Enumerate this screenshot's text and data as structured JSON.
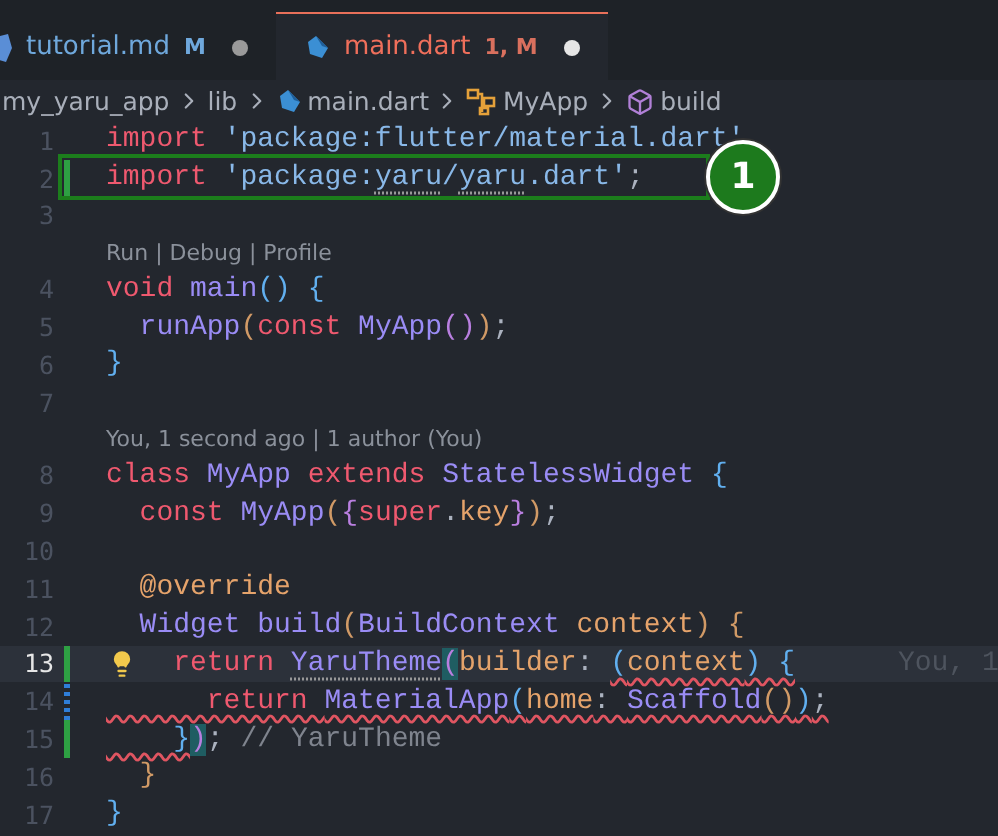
{
  "tabs": [
    {
      "label": "tutorial.md",
      "status": "M",
      "kind": "markdown",
      "selected": false,
      "dirty": true
    },
    {
      "label": "main.dart",
      "status": "1, M",
      "kind": "dart",
      "selected": true,
      "dirty": true
    }
  ],
  "breadcrumb": [
    {
      "label": "my_yaru_app",
      "kind": "folder"
    },
    {
      "label": "lib",
      "kind": "folder"
    },
    {
      "label": "main.dart",
      "kind": "dart"
    },
    {
      "label": "MyApp",
      "kind": "class"
    },
    {
      "label": "build",
      "kind": "method"
    }
  ],
  "annotation": {
    "label": "1"
  },
  "lines": [
    {
      "number": "1",
      "kind": "plain",
      "tokens": [
        {
          "t": "import ",
          "kind": "kw"
        },
        {
          "t": "'package:flutter/material.dart'",
          "kind": "str"
        }
      ]
    },
    {
      "number": "2",
      "kind": "added",
      "highlighted": true,
      "tokens": [
        {
          "t": "import ",
          "kind": "kw"
        },
        {
          "t": "'package:",
          "kind": "str"
        },
        {
          "t": "yaru",
          "kind": "str",
          "hint": true
        },
        {
          "t": "/",
          "kind": "str"
        },
        {
          "t": "yaru",
          "kind": "str",
          "hint": true
        },
        {
          "t": ".dart'",
          "kind": "str"
        },
        {
          "t": ";",
          "kind": "p"
        }
      ]
    },
    {
      "number": "3",
      "kind": "plain"
    },
    {
      "number": "4",
      "kind": "plain",
      "lens": "Run | Debug | Profile",
      "tokens": [
        {
          "t": "void ",
          "kind": "kw"
        },
        {
          "t": "main",
          "kind": "fn"
        },
        {
          "t": "() {",
          "kind": "b3"
        }
      ]
    },
    {
      "number": "5",
      "kind": "plain",
      "tokens": [
        {
          "t": "  runApp",
          "kind": "fn"
        },
        {
          "t": "(",
          "kind": "b1"
        },
        {
          "t": "const ",
          "kind": "kw"
        },
        {
          "t": "MyApp",
          "kind": "fn"
        },
        {
          "t": "()",
          "kind": "b2"
        },
        {
          "t": ")",
          "kind": "b1"
        },
        {
          "t": ";",
          "kind": "p"
        }
      ]
    },
    {
      "number": "6",
      "kind": "plain",
      "tokens": [
        {
          "t": "}",
          "kind": "b3"
        }
      ]
    },
    {
      "number": "7",
      "kind": "plain"
    },
    {
      "number": "8",
      "kind": "plain",
      "lens": "You, 1 second ago | 1 author (You)",
      "tokens": [
        {
          "t": "class ",
          "kind": "kw"
        },
        {
          "t": "MyApp ",
          "kind": "fn"
        },
        {
          "t": "extends ",
          "kind": "kw"
        },
        {
          "t": "StatelessWidget ",
          "kind": "fn"
        },
        {
          "t": "{",
          "kind": "b3"
        }
      ]
    },
    {
      "number": "9",
      "kind": "plain",
      "tokens": [
        {
          "t": "  const ",
          "kind": "kw"
        },
        {
          "t": "MyApp",
          "kind": "fn"
        },
        {
          "t": "(",
          "kind": "b1"
        },
        {
          "t": "{",
          "kind": "b2"
        },
        {
          "t": "super",
          "kind": "kw"
        },
        {
          "t": ".",
          "kind": "p"
        },
        {
          "t": "key",
          "kind": "prm"
        },
        {
          "t": "}",
          "kind": "b2"
        },
        {
          "t": ")",
          "kind": "b1"
        },
        {
          "t": ";",
          "kind": "p"
        }
      ]
    },
    {
      "number": "10",
      "kind": "plain"
    },
    {
      "number": "11",
      "kind": "plain",
      "tokens": [
        {
          "t": "  @override",
          "kind": "prm"
        }
      ]
    },
    {
      "number": "12",
      "kind": "plain",
      "tokens": [
        {
          "t": "  Widget ",
          "kind": "fn"
        },
        {
          "t": "build",
          "kind": "fn"
        },
        {
          "t": "(",
          "kind": "b1"
        },
        {
          "t": "BuildContext ",
          "kind": "fn"
        },
        {
          "t": "context",
          "kind": "prm"
        },
        {
          "t": ") ",
          "kind": "b1"
        },
        {
          "t": "{",
          "kind": "b1"
        }
      ]
    },
    {
      "number": "13",
      "kind": "added",
      "current": true,
      "bulb": true,
      "ghost": "You, 1",
      "tokens": [
        {
          "t": "    return ",
          "kind": "kw"
        },
        {
          "t": "YaruTheme",
          "kind": "fn",
          "hint": true
        },
        {
          "t": "(",
          "kind": "b2",
          "match": true
        },
        {
          "t": "builder",
          "kind": "prm"
        },
        {
          "t": ": ",
          "kind": "p"
        },
        {
          "t": "(",
          "kind": "b3",
          "error": true
        },
        {
          "t": "context",
          "kind": "prm",
          "error": true
        },
        {
          "t": ") {",
          "kind": "b3",
          "error": true
        }
      ]
    },
    {
      "number": "14",
      "kind": "modified",
      "tokens": [
        {
          "t": "      return ",
          "kind": "kw",
          "error": true
        },
        {
          "t": "MaterialApp",
          "kind": "fn",
          "error": true
        },
        {
          "t": "(",
          "kind": "b3",
          "error": true
        },
        {
          "t": "home",
          "kind": "prm",
          "error": true
        },
        {
          "t": ": ",
          "kind": "p",
          "error": true
        },
        {
          "t": "Scaffold",
          "kind": "fn",
          "error": true
        },
        {
          "t": "()",
          "kind": "b1",
          "error": true
        },
        {
          "t": ")",
          "kind": "b3",
          "error": true
        },
        {
          "t": ";",
          "kind": "p",
          "error": true
        }
      ]
    },
    {
      "number": "15",
      "kind": "added",
      "tokens": [
        {
          "t": "    }",
          "kind": "b3",
          "error": true
        },
        {
          "t": ")",
          "kind": "b2",
          "match": true
        },
        {
          "t": "; ",
          "kind": "p"
        },
        {
          "t": "// YaruTheme",
          "kind": "cm"
        }
      ]
    },
    {
      "number": "16",
      "kind": "plain",
      "tokens": [
        {
          "t": "  }",
          "kind": "b1"
        }
      ]
    },
    {
      "number": "17",
      "kind": "plain",
      "tokens": [
        {
          "t": "}",
          "kind": "b3"
        }
      ]
    }
  ]
}
